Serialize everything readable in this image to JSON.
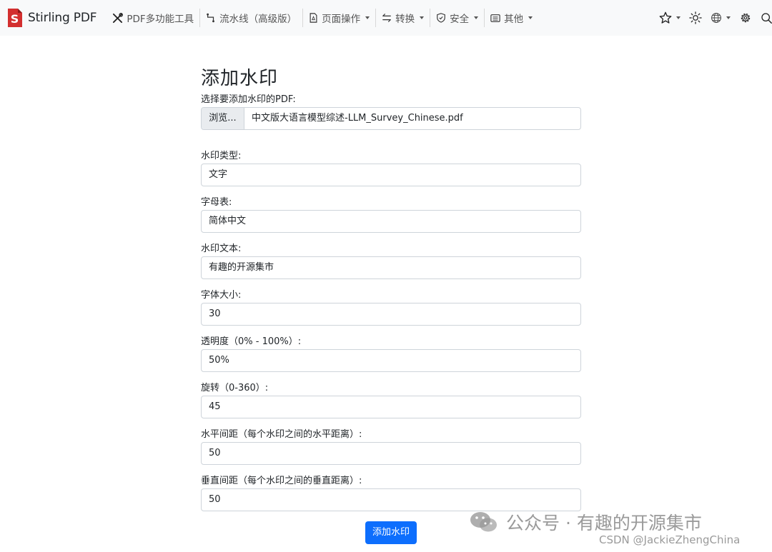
{
  "navbar": {
    "brand": "Stirling PDF",
    "items": [
      {
        "label": "PDF多功能工具",
        "icon": "tools-icon",
        "dropdown": false
      },
      {
        "label": "流水线（高级版）",
        "icon": "pipeline-icon",
        "dropdown": false
      },
      {
        "label": "页面操作",
        "icon": "file-page-icon",
        "dropdown": true
      },
      {
        "label": "转换",
        "icon": "arrows-exchange-icon",
        "dropdown": true
      },
      {
        "label": "安全",
        "icon": "shield-check-icon",
        "dropdown": true
      },
      {
        "label": "其他",
        "icon": "card-list-icon",
        "dropdown": true
      }
    ],
    "right_icons": [
      "star-icon",
      "sun-icon",
      "globe-icon",
      "gear-icon",
      "search-icon"
    ]
  },
  "form": {
    "title": "添加水印",
    "file_label": "选择要添加水印的PDF:",
    "browse_label": "浏览...",
    "file_name": "中文版大语言模型综述-LLM_Survey_Chinese.pdf",
    "fields": [
      {
        "label": "水印类型:",
        "value": "文字"
      },
      {
        "label": "字母表:",
        "value": "简体中文"
      },
      {
        "label": "水印文本:",
        "value": "有趣的开源集市"
      },
      {
        "label": "字体大小:",
        "value": "30"
      },
      {
        "label": "透明度（0% - 100%）:",
        "value": "50%"
      },
      {
        "label": "旋转（0-360）:",
        "value": "45"
      },
      {
        "label": "水平间距（每个水印之间的水平距离）:",
        "value": "50"
      },
      {
        "label": "垂直间距（每个水印之间的垂直距离）:",
        "value": "50"
      }
    ],
    "submit_label": "添加水印"
  },
  "watermark": {
    "line1": "公众号 · 有趣的开源集市",
    "line2": "CSDN @JackieZhengChina"
  },
  "colors": {
    "accent": "#0d6efd",
    "brand_red": "#d32f2f",
    "navbar_bg": "#f8f9fa"
  }
}
